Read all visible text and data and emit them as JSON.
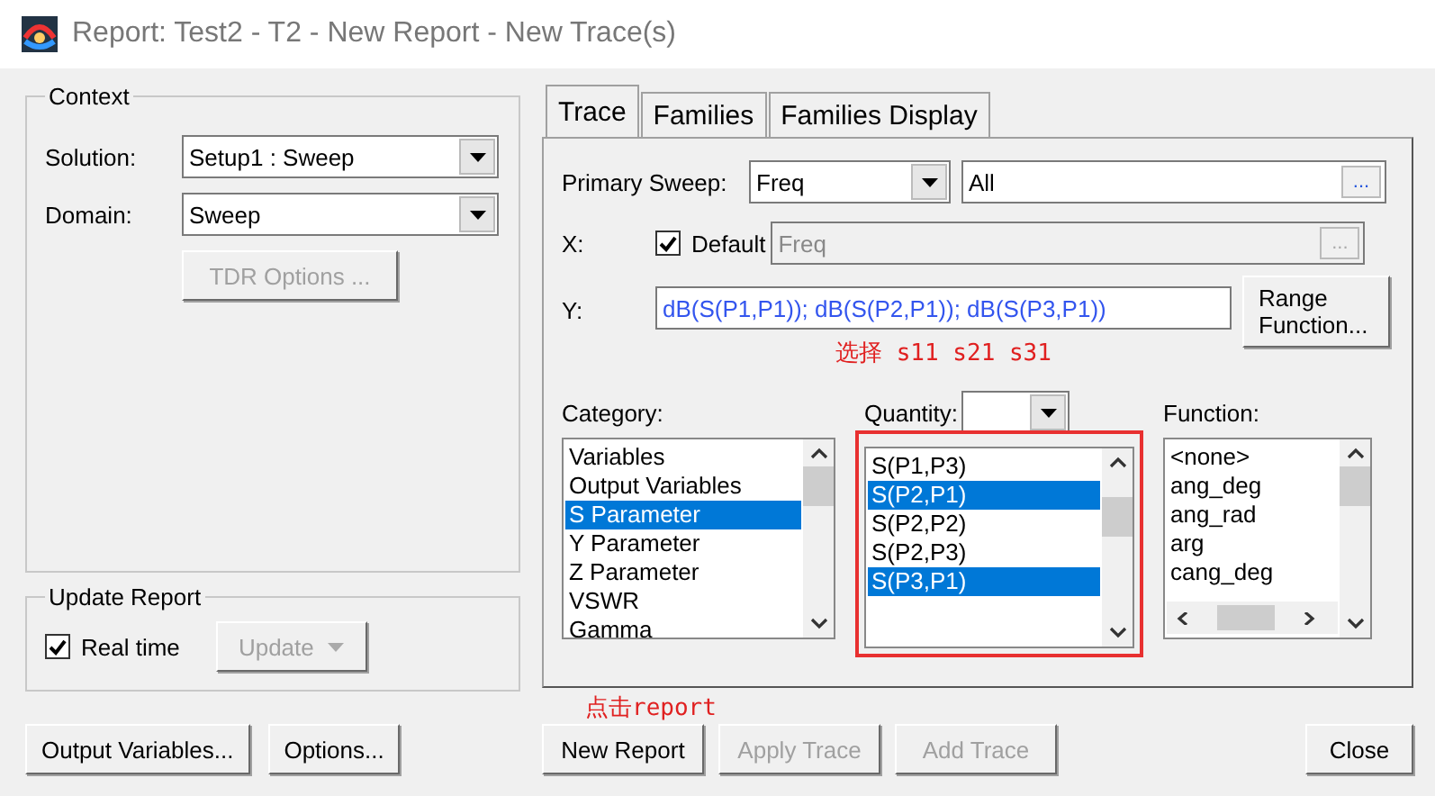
{
  "window": {
    "title": "Report: Test2 - T2 - New Report - New Trace(s)"
  },
  "context": {
    "title": "Context",
    "solution": {
      "label": "Solution:",
      "value": "Setup1 : Sweep"
    },
    "domain": {
      "label": "Domain:",
      "value": "Sweep"
    },
    "tdr_button": {
      "label": "TDR Options ...",
      "disabled": true
    }
  },
  "update_report": {
    "title": "Update Report",
    "real_time": {
      "label": "Real time",
      "checked": true
    },
    "update_button": {
      "label": "Update",
      "disabled": true
    }
  },
  "left_buttons": [
    {
      "label": "Output Variables...",
      "disabled": false
    },
    {
      "label": "Options...",
      "disabled": false
    }
  ],
  "tabs": [
    {
      "label": "Trace",
      "selected": true
    },
    {
      "label": "Families",
      "selected": false
    },
    {
      "label": "Families Display",
      "selected": false
    }
  ],
  "primary_sweep": {
    "label": "Primary Sweep:",
    "value": "Freq",
    "range": "All",
    "browse": "..."
  },
  "x": {
    "label": "X:",
    "default_label": "Default",
    "default_checked": true,
    "value": "Freq",
    "browse": "..."
  },
  "y": {
    "label": "Y:",
    "value": "dB(S(P1,P1)); dB(S(P2,P1)); dB(S(P3,P1))",
    "range_button": "Range Function..."
  },
  "category": {
    "label": "Category:",
    "items": [
      {
        "label": "Variables",
        "selected": false
      },
      {
        "label": "Output Variables",
        "selected": false
      },
      {
        "label": "S Parameter",
        "selected": true
      },
      {
        "label": "Y Parameter",
        "selected": false
      },
      {
        "label": "Z Parameter",
        "selected": false
      },
      {
        "label": "VSWR",
        "selected": false
      },
      {
        "label": "Gamma",
        "selected": false
      }
    ]
  },
  "quantity": {
    "label": "Quantity:",
    "items": [
      {
        "label": "S(P1,P3)",
        "selected": false
      },
      {
        "label": "S(P2,P1)",
        "selected": true
      },
      {
        "label": "S(P2,P2)",
        "selected": false
      },
      {
        "label": "S(P2,P3)",
        "selected": false
      },
      {
        "label": "S(P3,P1)",
        "selected": true
      }
    ]
  },
  "function": {
    "label": "Function:",
    "items": [
      {
        "label": "<none>",
        "selected": false
      },
      {
        "label": "ang_deg",
        "selected": false
      },
      {
        "label": "ang_rad",
        "selected": false
      },
      {
        "label": "arg",
        "selected": false
      },
      {
        "label": "cang_deg",
        "selected": false
      }
    ]
  },
  "bottom_buttons": [
    {
      "label": "New Report",
      "disabled": false
    },
    {
      "label": "Apply Trace",
      "disabled": true
    },
    {
      "label": "Add Trace",
      "disabled": true
    },
    {
      "label": "Close",
      "disabled": false
    }
  ],
  "annotations": {
    "select_note": "选择 s11 s21 s31",
    "click_note": "点击report"
  }
}
